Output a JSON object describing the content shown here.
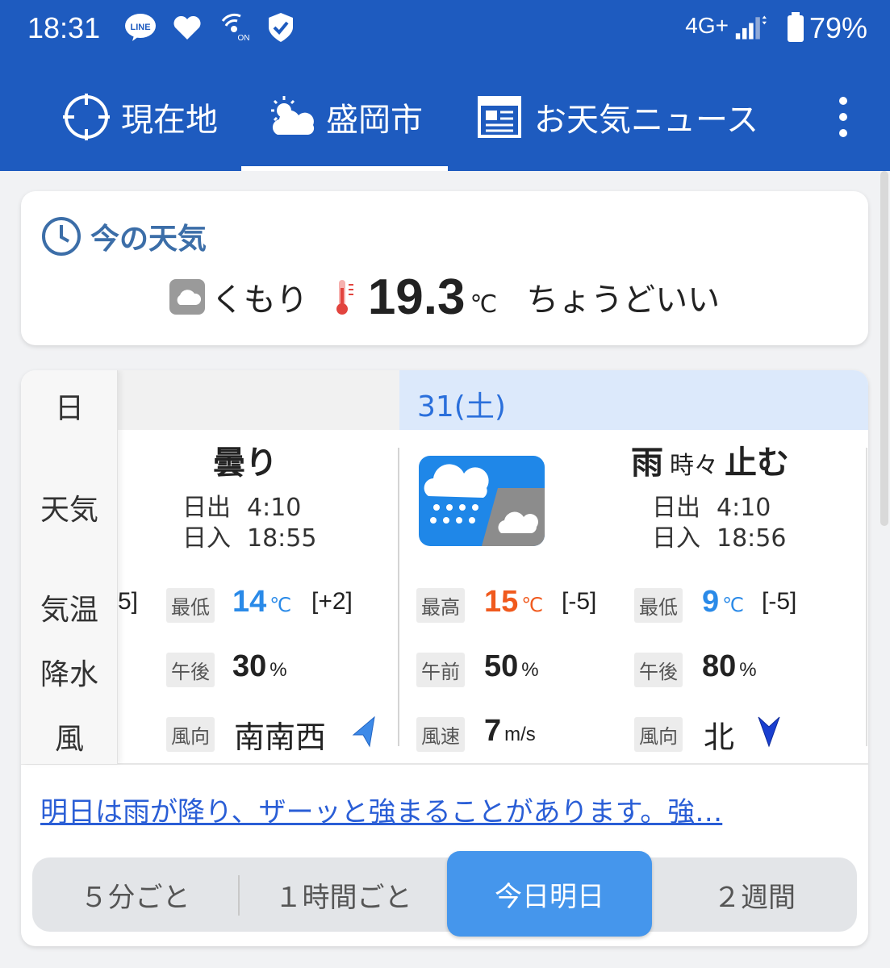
{
  "status_bar": {
    "time": "18:31",
    "network": "4G+",
    "battery": "79%",
    "icons": [
      "line-icon",
      "heart-icon",
      "wifi-calling-icon",
      "shield-check-icon",
      "signal-icon",
      "battery-icon"
    ]
  },
  "tabs": [
    {
      "label": "現在地",
      "icon": "location-crosshair-icon"
    },
    {
      "label": "盛岡市",
      "icon": "partly-cloudy-icon",
      "selected": true
    },
    {
      "label": "お天気ニュース",
      "icon": "newspaper-icon"
    }
  ],
  "now": {
    "title": "今の天気",
    "condition": "くもり",
    "temperature": "19.3",
    "unit": "℃",
    "feel": "ちょうどいい"
  },
  "forecast": {
    "row_headers": {
      "day": "日",
      "weather": "天気",
      "temp": "気温",
      "precip": "降水",
      "wind": "風"
    },
    "date": "31(土)",
    "partial_left": "5]",
    "today": {
      "weather": "曇り",
      "sunrise_label": "日出",
      "sunrise": "4:10",
      "sunset_label": "日入",
      "sunset": "18:55",
      "low_label": "最低",
      "low": "14",
      "low_diff": "[+2]",
      "precip_label": "午後",
      "precip": "30",
      "wind_label": "風向",
      "wind_dir": "南南西"
    },
    "tomorrow": {
      "weather_main": "雨",
      "weather_mid": "時々",
      "weather_end": "止む",
      "sunrise_label": "日出",
      "sunrise": "4:10",
      "sunset_label": "日入",
      "sunset": "18:56",
      "high_label": "最高",
      "high": "15",
      "high_diff": "[-5]",
      "low_label": "最低",
      "low": "9",
      "low_diff": "[-5]",
      "precip_am_label": "午前",
      "precip_am": "50",
      "precip_pm_label": "午後",
      "precip_pm": "80",
      "wind_speed_label": "風速",
      "wind_speed": "7",
      "wind_speed_unit": "m/s",
      "wind_dir_label": "風向",
      "wind_dir": "北"
    },
    "temp_unit": "℃",
    "percent_unit": "%"
  },
  "news_link": "明日は雨が降り、ザーッと強まることがあります。強…",
  "segments": [
    "５分ごと",
    "１時間ごと",
    "今日明日",
    "２週間"
  ],
  "selected_segment": "今日明日",
  "colors": {
    "brand_blue": "#1e5bbf",
    "high_temp": "#f05a1e",
    "low_temp": "#2a8ae8",
    "link": "#2a5ed6",
    "segment_active": "#4596ec"
  }
}
